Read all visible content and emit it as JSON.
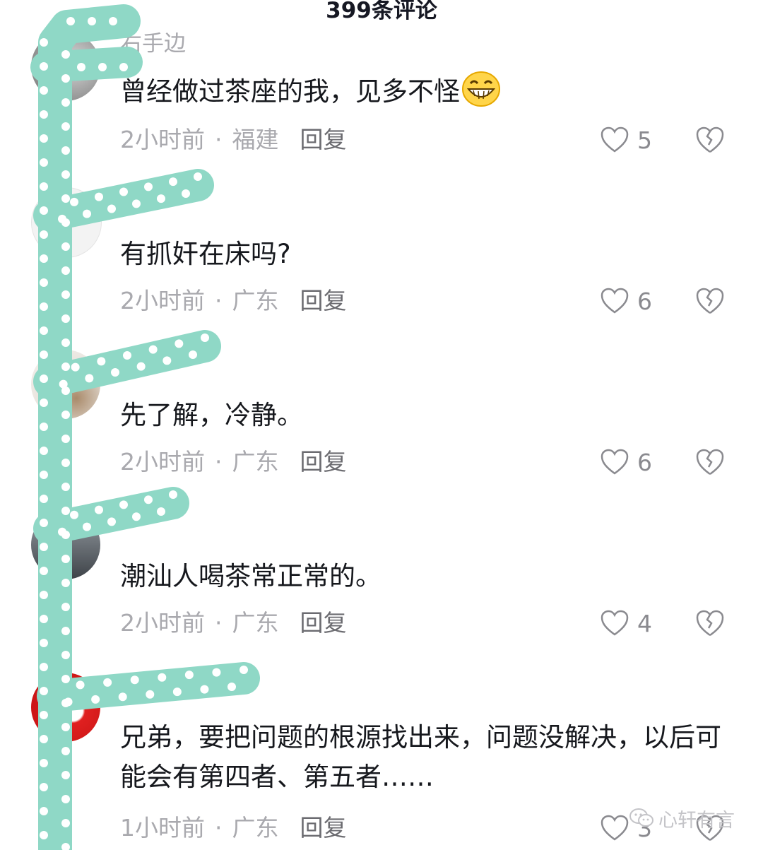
{
  "header": {
    "title": "399条评论"
  },
  "comments": [
    {
      "username": "右手边",
      "text": "曾经做过茶座的我，见多不怪",
      "emoji": "grinning-face-icon",
      "time": "2小时前",
      "separator": "·",
      "location": "福建",
      "reply": "回复",
      "likes": "5"
    },
    {
      "username": "",
      "text": "有抓奸在床吗?",
      "time": "2小时前",
      "separator": "·",
      "location": "广东",
      "reply": "回复",
      "likes": "6"
    },
    {
      "username": "",
      "text": "先了解，冷静。",
      "time": "2小时前",
      "separator": "·",
      "location": "广东",
      "reply": "回复",
      "likes": "6"
    },
    {
      "username": "",
      "text": "潮汕人喝茶常正常的。",
      "time": "2小时前",
      "separator": "·",
      "location": "广东",
      "reply": "回复",
      "likes": "4"
    },
    {
      "username": "",
      "text": "兄弟，要把问题的根源找出来，问题没解决，以后可能会有第四者、第五者……",
      "time": "1小时前",
      "separator": "·",
      "location": "广东",
      "reply": "回复",
      "likes": "3"
    }
  ],
  "watermark": {
    "text": "心轩有言"
  },
  "colors": {
    "overlay": "#8fd8c6",
    "overlay_dots": "#ffffff",
    "meta_text": "#a9a9ae"
  }
}
